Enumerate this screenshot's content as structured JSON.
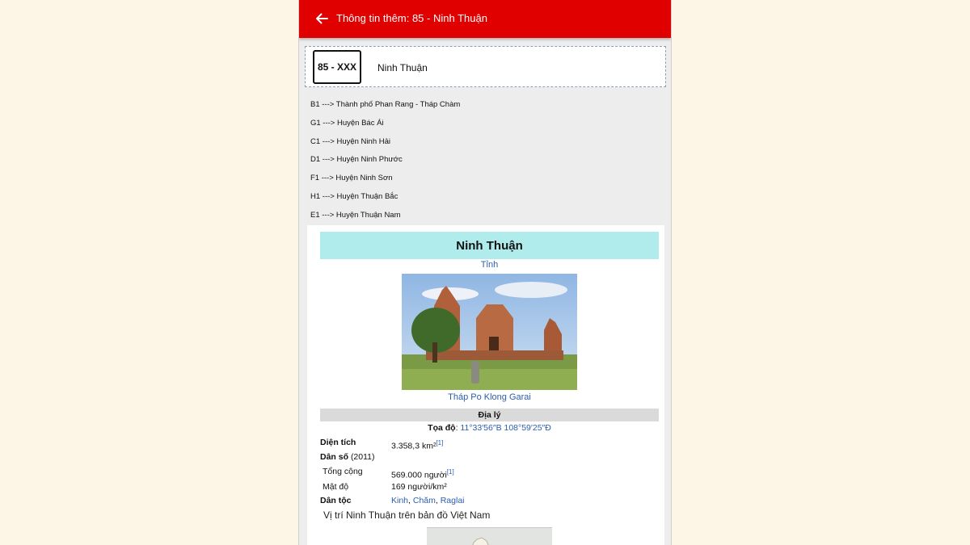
{
  "appbar": {
    "title": "Thông tin thêm: 85 - Ninh Thuận",
    "color": "#e00000"
  },
  "plate": {
    "code": "85 - XXX",
    "province": "Ninh Thuận"
  },
  "district_codes": [
    "B1 ---> Thành phố Phan Rang - Tháp Chàm",
    "G1 ---> Huyện Bác Ái",
    "C1 ---> Huyện Ninh Hải",
    "D1 ---> Huyện Ninh Phước",
    "F1 ---> Huyện Ninh Sơn",
    "H1 ---> Huyện Thuận Bắc",
    "E1 ---> Huyện Thuận Nam"
  ],
  "wiki": {
    "title": "Ninh Thuận",
    "type": "Tỉnh",
    "photo_caption": "Tháp Po Klong Garai",
    "section": "Địa lý",
    "coord_label": "Tọa độ",
    "coord_value": "11°33′56″B 108°59′25″Đ",
    "area_label": "Diện tích",
    "area_value": "3.358,3 km²",
    "area_ref": "[1]",
    "population_label": "Dân số",
    "population_year": "(2011)",
    "total_label": "Tổng cộng",
    "total_value": "569.000 người",
    "total_ref": "[1]",
    "density_label": "Mật độ",
    "density_value": "169 người/km²",
    "ethnic_label": "Dân tộc",
    "ethnic_1": "Kinh",
    "ethnic_2": "Chăm",
    "ethnic_3": "Raglai",
    "map_caption": "Vị trí Ninh Thuận trên bản đồ Việt Nam"
  }
}
